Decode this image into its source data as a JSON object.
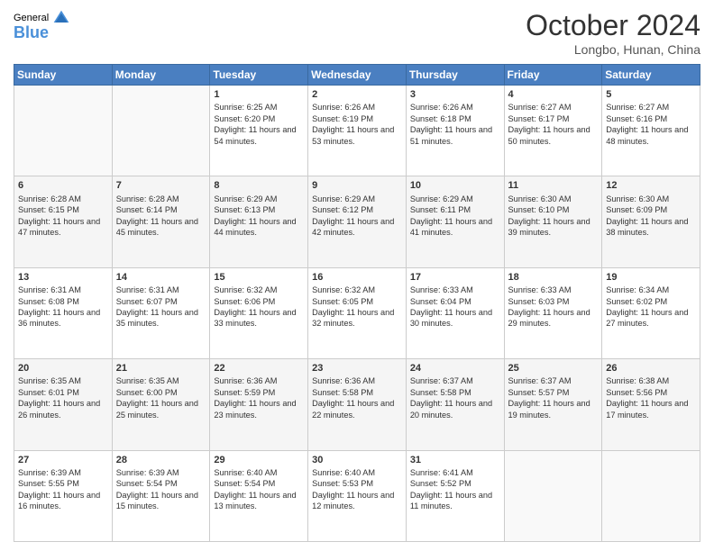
{
  "logo": {
    "general": "General",
    "blue": "Blue"
  },
  "title": "October 2024",
  "location": "Longbo, Hunan, China",
  "headers": [
    "Sunday",
    "Monday",
    "Tuesday",
    "Wednesday",
    "Thursday",
    "Friday",
    "Saturday"
  ],
  "weeks": [
    [
      {
        "day": "",
        "info": ""
      },
      {
        "day": "",
        "info": ""
      },
      {
        "day": "1",
        "info": "Sunrise: 6:25 AM\nSunset: 6:20 PM\nDaylight: 11 hours and 54 minutes."
      },
      {
        "day": "2",
        "info": "Sunrise: 6:26 AM\nSunset: 6:19 PM\nDaylight: 11 hours and 53 minutes."
      },
      {
        "day": "3",
        "info": "Sunrise: 6:26 AM\nSunset: 6:18 PM\nDaylight: 11 hours and 51 minutes."
      },
      {
        "day": "4",
        "info": "Sunrise: 6:27 AM\nSunset: 6:17 PM\nDaylight: 11 hours and 50 minutes."
      },
      {
        "day": "5",
        "info": "Sunrise: 6:27 AM\nSunset: 6:16 PM\nDaylight: 11 hours and 48 minutes."
      }
    ],
    [
      {
        "day": "6",
        "info": "Sunrise: 6:28 AM\nSunset: 6:15 PM\nDaylight: 11 hours and 47 minutes."
      },
      {
        "day": "7",
        "info": "Sunrise: 6:28 AM\nSunset: 6:14 PM\nDaylight: 11 hours and 45 minutes."
      },
      {
        "day": "8",
        "info": "Sunrise: 6:29 AM\nSunset: 6:13 PM\nDaylight: 11 hours and 44 minutes."
      },
      {
        "day": "9",
        "info": "Sunrise: 6:29 AM\nSunset: 6:12 PM\nDaylight: 11 hours and 42 minutes."
      },
      {
        "day": "10",
        "info": "Sunrise: 6:29 AM\nSunset: 6:11 PM\nDaylight: 11 hours and 41 minutes."
      },
      {
        "day": "11",
        "info": "Sunrise: 6:30 AM\nSunset: 6:10 PM\nDaylight: 11 hours and 39 minutes."
      },
      {
        "day": "12",
        "info": "Sunrise: 6:30 AM\nSunset: 6:09 PM\nDaylight: 11 hours and 38 minutes."
      }
    ],
    [
      {
        "day": "13",
        "info": "Sunrise: 6:31 AM\nSunset: 6:08 PM\nDaylight: 11 hours and 36 minutes."
      },
      {
        "day": "14",
        "info": "Sunrise: 6:31 AM\nSunset: 6:07 PM\nDaylight: 11 hours and 35 minutes."
      },
      {
        "day": "15",
        "info": "Sunrise: 6:32 AM\nSunset: 6:06 PM\nDaylight: 11 hours and 33 minutes."
      },
      {
        "day": "16",
        "info": "Sunrise: 6:32 AM\nSunset: 6:05 PM\nDaylight: 11 hours and 32 minutes."
      },
      {
        "day": "17",
        "info": "Sunrise: 6:33 AM\nSunset: 6:04 PM\nDaylight: 11 hours and 30 minutes."
      },
      {
        "day": "18",
        "info": "Sunrise: 6:33 AM\nSunset: 6:03 PM\nDaylight: 11 hours and 29 minutes."
      },
      {
        "day": "19",
        "info": "Sunrise: 6:34 AM\nSunset: 6:02 PM\nDaylight: 11 hours and 27 minutes."
      }
    ],
    [
      {
        "day": "20",
        "info": "Sunrise: 6:35 AM\nSunset: 6:01 PM\nDaylight: 11 hours and 26 minutes."
      },
      {
        "day": "21",
        "info": "Sunrise: 6:35 AM\nSunset: 6:00 PM\nDaylight: 11 hours and 25 minutes."
      },
      {
        "day": "22",
        "info": "Sunrise: 6:36 AM\nSunset: 5:59 PM\nDaylight: 11 hours and 23 minutes."
      },
      {
        "day": "23",
        "info": "Sunrise: 6:36 AM\nSunset: 5:58 PM\nDaylight: 11 hours and 22 minutes."
      },
      {
        "day": "24",
        "info": "Sunrise: 6:37 AM\nSunset: 5:58 PM\nDaylight: 11 hours and 20 minutes."
      },
      {
        "day": "25",
        "info": "Sunrise: 6:37 AM\nSunset: 5:57 PM\nDaylight: 11 hours and 19 minutes."
      },
      {
        "day": "26",
        "info": "Sunrise: 6:38 AM\nSunset: 5:56 PM\nDaylight: 11 hours and 17 minutes."
      }
    ],
    [
      {
        "day": "27",
        "info": "Sunrise: 6:39 AM\nSunset: 5:55 PM\nDaylight: 11 hours and 16 minutes."
      },
      {
        "day": "28",
        "info": "Sunrise: 6:39 AM\nSunset: 5:54 PM\nDaylight: 11 hours and 15 minutes."
      },
      {
        "day": "29",
        "info": "Sunrise: 6:40 AM\nSunset: 5:54 PM\nDaylight: 11 hours and 13 minutes."
      },
      {
        "day": "30",
        "info": "Sunrise: 6:40 AM\nSunset: 5:53 PM\nDaylight: 11 hours and 12 minutes."
      },
      {
        "day": "31",
        "info": "Sunrise: 6:41 AM\nSunset: 5:52 PM\nDaylight: 11 hours and 11 minutes."
      },
      {
        "day": "",
        "info": ""
      },
      {
        "day": "",
        "info": ""
      }
    ]
  ]
}
